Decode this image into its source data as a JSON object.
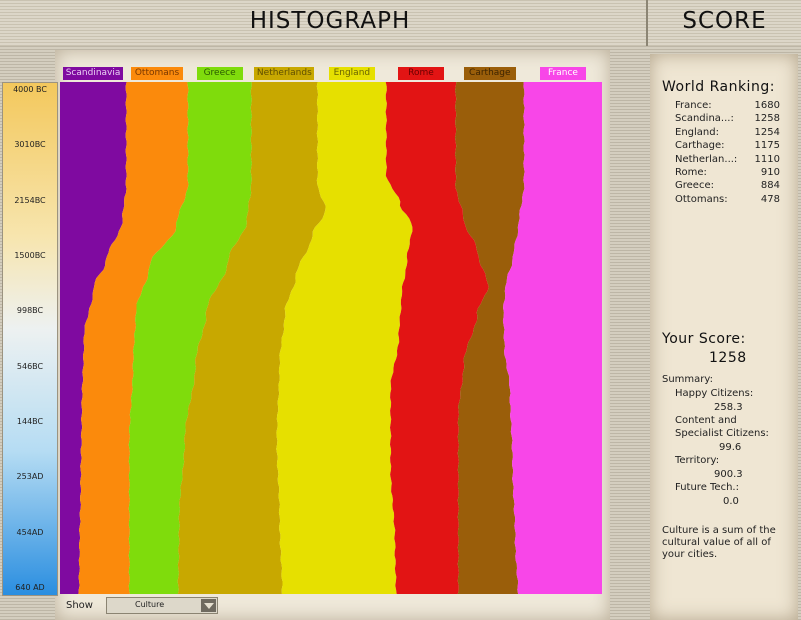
{
  "header": {
    "title": "HISTOGRAPH",
    "score_title": "SCORE"
  },
  "scale_ticks": [
    "4000 BC",
    "3010BC",
    "2154BC",
    "1500BC",
    "998BC",
    "546BC",
    "144BC",
    "253AD",
    "454AD",
    "640 AD"
  ],
  "legend": [
    {
      "label": "Scandinavia",
      "color": "#7f0aa0",
      "text_color": "#e9d0f3"
    },
    {
      "label": "Ottomans",
      "color": "#fb8a0c",
      "text_color": "#7a3800"
    },
    {
      "label": "Greece",
      "color": "#7fdc0c",
      "text_color": "#2a5a00"
    },
    {
      "label": "Netherlands",
      "color": "#c8a800",
      "text_color": "#604f00"
    },
    {
      "label": "England",
      "color": "#e6e000",
      "text_color": "#6a6500"
    },
    {
      "label": "Rome",
      "color": "#e21414",
      "text_color": "#6a0000"
    },
    {
      "label": "Carthage",
      "color": "#9a5e0a",
      "text_color": "#3f2500"
    },
    {
      "label": "France",
      "color": "#f846e8",
      "text_color": "#ffffff"
    }
  ],
  "chart_data": {
    "type": "area",
    "title": "HISTOGRAPH",
    "measure": "Culture",
    "time_axis_ticks": [
      "4000 BC",
      "3010BC",
      "2154BC",
      "1500BC",
      "998BC",
      "546BC",
      "144BC",
      "253AD",
      "454AD",
      "640 AD"
    ],
    "stacked_order": [
      "Scandinavia",
      "Ottomans",
      "Greece",
      "Netherlands",
      "England",
      "Rome",
      "Carthage",
      "France"
    ],
    "boundary_profiles_estimated": [
      {
        "y": [
          0.0,
          0.2,
          0.27,
          0.35,
          0.4,
          0.5,
          0.65,
          0.8,
          0.9,
          1.0
        ],
        "x": [
          0.122,
          0.122,
          0.115,
          0.085,
          0.062,
          0.044,
          0.04,
          0.038,
          0.036,
          0.035
        ]
      },
      {
        "y": [
          0.0,
          0.2,
          0.28,
          0.36,
          0.45,
          0.55,
          0.7,
          0.85,
          1.0
        ],
        "x": [
          0.236,
          0.236,
          0.215,
          0.165,
          0.14,
          0.135,
          0.128,
          0.128,
          0.128
        ]
      },
      {
        "y": [
          0.0,
          0.2,
          0.27,
          0.35,
          0.45,
          0.55,
          0.7,
          0.85,
          1.0
        ],
        "x": [
          0.353,
          0.353,
          0.345,
          0.31,
          0.27,
          0.25,
          0.23,
          0.22,
          0.218
        ]
      },
      {
        "y": [
          0.0,
          0.2,
          0.25,
          0.3,
          0.38,
          0.45,
          0.55,
          0.7,
          0.85,
          1.0
        ],
        "x": [
          0.475,
          0.475,
          0.49,
          0.465,
          0.435,
          0.415,
          0.405,
          0.4,
          0.405,
          0.41
        ]
      },
      {
        "y": [
          0.0,
          0.18,
          0.24,
          0.28,
          0.35,
          0.42,
          0.5,
          0.6,
          0.75,
          0.9,
          1.0
        ],
        "x": [
          0.602,
          0.602,
          0.628,
          0.65,
          0.64,
          0.63,
          0.625,
          0.61,
          0.61,
          0.618,
          0.62
        ]
      },
      {
        "y": [
          0.0,
          0.2,
          0.27,
          0.33,
          0.4,
          0.45,
          0.55,
          0.65,
          0.8,
          1.0
        ],
        "x": [
          0.73,
          0.73,
          0.745,
          0.77,
          0.79,
          0.77,
          0.745,
          0.735,
          0.735,
          0.735
        ]
      },
      {
        "y": [
          0.0,
          0.2,
          0.28,
          0.34,
          0.4,
          0.45,
          0.52,
          0.6,
          0.75,
          0.9,
          1.0
        ],
        "x": [
          0.856,
          0.856,
          0.846,
          0.836,
          0.822,
          0.818,
          0.82,
          0.83,
          0.835,
          0.84,
          0.845
        ]
      }
    ]
  },
  "controls": {
    "show_label": "Show",
    "show_value": "Culture"
  },
  "ranking": {
    "title": "World Ranking:",
    "rows": [
      {
        "name": "France:",
        "score": "1680"
      },
      {
        "name": "Scandina...:",
        "score": "1258"
      },
      {
        "name": "England:",
        "score": "1254"
      },
      {
        "name": "Carthage:",
        "score": "1175"
      },
      {
        "name": "Netherlan...:",
        "score": "1110"
      },
      {
        "name": "Rome:",
        "score": "910"
      },
      {
        "name": "Greece:",
        "score": "884"
      },
      {
        "name": "Ottomans:",
        "score": "478"
      }
    ]
  },
  "your_score": {
    "title": "Your Score:",
    "value": "1258",
    "summary_label": "Summary:",
    "happy_label": "Happy Citizens:",
    "happy_value": "258.3",
    "content_label_1": "Content and",
    "content_label_2": "Specialist Citizens:",
    "content_value": "99.6",
    "territory_label": "Territory:",
    "territory_value": "900.3",
    "future_label": "Future Tech.:",
    "future_value": "0.0",
    "note": "Culture is a sum of the cultural value of all of your cities."
  }
}
